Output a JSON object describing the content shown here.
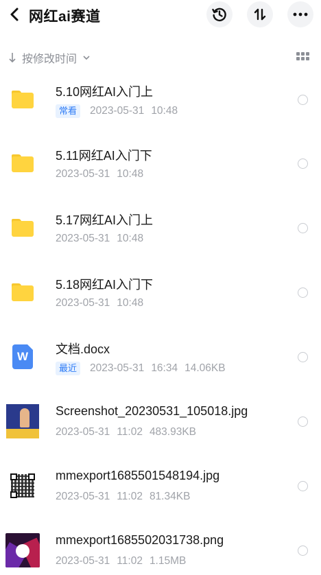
{
  "header": {
    "title": "网红ai赛道",
    "back_icon": "chevron-left-icon",
    "history_icon": "history-icon",
    "sort_icon": "sort-arrows-icon",
    "more_icon": "more-dots-icon"
  },
  "sortbar": {
    "label": "按修改时间",
    "arrow_icon": "down-arrow-icon",
    "chevron_icon": "chevron-down-icon",
    "view_toggle_icon": "grid-view-icon"
  },
  "files": [
    {
      "name": "5.10网红AI入门上",
      "type": "folder",
      "tag": "常看",
      "date": "2023-05-31",
      "time": "10:48",
      "size": ""
    },
    {
      "name": "5.11网红AI入门下",
      "type": "folder",
      "tag": "",
      "date": "2023-05-31",
      "time": "10:48",
      "size": ""
    },
    {
      "name": "5.17网红AI入门上",
      "type": "folder",
      "tag": "",
      "date": "2023-05-31",
      "time": "10:48",
      "size": ""
    },
    {
      "name": "5.18网红AI入门下",
      "type": "folder",
      "tag": "",
      "date": "2023-05-31",
      "time": "10:48",
      "size": ""
    },
    {
      "name": "文档.docx",
      "type": "docx",
      "tag": "最近",
      "date": "2023-05-31",
      "time": "16:34",
      "size": "14.06KB"
    },
    {
      "name": "Screenshot_20230531_105018.jpg",
      "type": "image",
      "tag": "",
      "date": "2023-05-31",
      "time": "11:02",
      "size": "483.93KB"
    },
    {
      "name": "mmexport1685501548194.jpg",
      "type": "image",
      "tag": "",
      "date": "2023-05-31",
      "time": "11:02",
      "size": "81.34KB"
    },
    {
      "name": "mmexport1685502031738.png",
      "type": "image",
      "tag": "",
      "date": "2023-05-31",
      "time": "11:02",
      "size": "1.15MB"
    }
  ],
  "docx_icon_letter": "W",
  "colors": {
    "folder": "#ffd43f",
    "tag_bg": "#e8f2ff",
    "tag_text": "#2f7cf6",
    "docx": "#4a8af4",
    "meta_text": "#a0a3a9"
  }
}
